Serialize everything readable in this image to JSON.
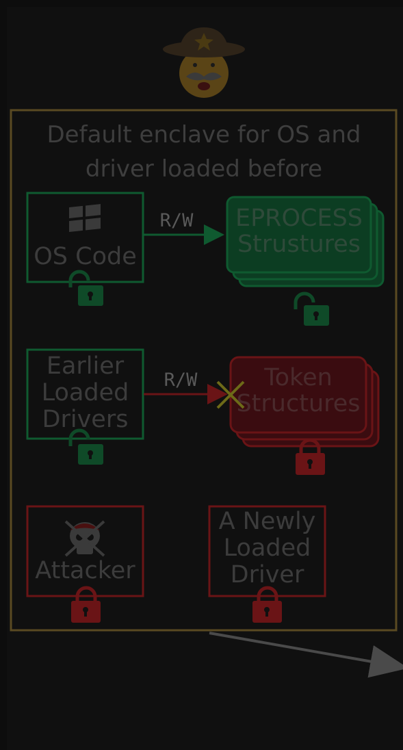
{
  "enclave": {
    "title": "Default enclave for OS and driver loaded before"
  },
  "nodes": {
    "os_code": "OS Code",
    "eprocess_line1": "EPROCESS",
    "eprocess_line2": "Strustures",
    "earlier_line1": "Earlier",
    "earlier_line2": "Loaded",
    "earlier_line3": "Drivers",
    "token_line1": "Token",
    "token_line2": "Structures",
    "attacker": "Attacker",
    "newly_line1": "A Newly",
    "newly_line2": "Loaded",
    "newly_line3": "Driver"
  },
  "edges": {
    "rw_label_top": "R/W",
    "rw_label_bottom": "R/W"
  },
  "colors": {
    "green": "#0f5a30",
    "red": "#6a1416",
    "gold": "#5a4a22",
    "x_mark": "#6d6a18"
  },
  "icons": [
    "sheriff-icon",
    "windows-logo-icon",
    "lock-open-icon",
    "lock-closed-icon",
    "pirate-skull-icon"
  ]
}
